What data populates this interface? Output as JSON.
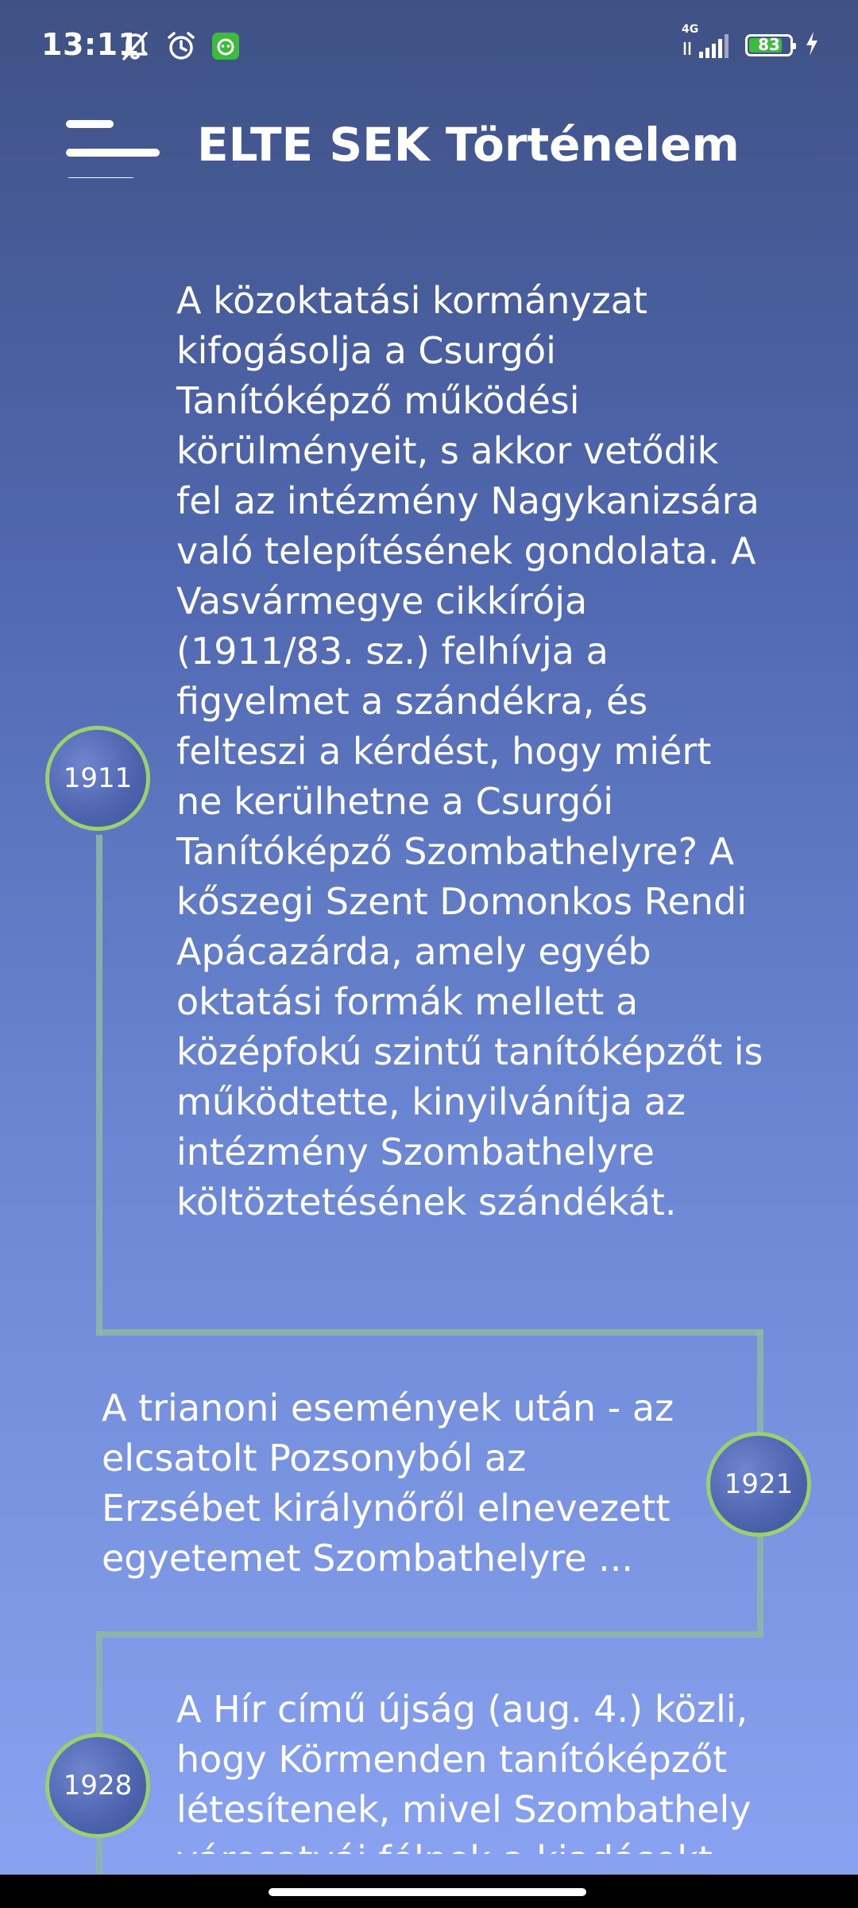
{
  "status_bar": {
    "time": "13:11",
    "network": "4G",
    "battery": "83",
    "battery_level": 0.83,
    "icons_left": [
      "mute-bell-icon",
      "alarm-icon",
      "app-notification-icon"
    ],
    "icons_right": [
      "signal-icon",
      "battery-icon",
      "charging-icon"
    ]
  },
  "app_bar": {
    "title": "ELTE SEK Történelem",
    "menu_icon": "hamburger-menu-icon"
  },
  "colors": {
    "background_top": "#3f5185",
    "background_bottom": "#8aa3f2",
    "circle_border": "#9ccf6f",
    "timeline": "#8eb9a4",
    "battery_fill": "#3dbb3d"
  },
  "timeline": [
    {
      "year": "1911",
      "text": "A közoktatási kormányzat kifogásolja a Csurgói Tanítóképző működési körülményeit, s akkor vetődik fel az intézmény Nagykanizsára való telepítésének gondolata. A Vasvármegye cikkírója (1911/83. sz.) felhívja a figyelmet a szándékra, és felteszi a kérdést, hogy miért ne kerülhetne a Csurgói Tanítóképző Szombathelyre? A kőszegi Szent Domonkos Rendi Apácazárda, amely egyéb oktatási formák mellett a középfokú szintű tanítóképzőt is működtette, kinyilvánítja az intézmény Szombathelyre költöztetésének szándékát."
    },
    {
      "year": "1921",
      "text": "A trianoni események után - az elcsatolt Pozsonyból az Erzsébet királynőről elnevezett egyetemet Szombathelyre ..."
    },
    {
      "year": "1928",
      "text": "A Hír című újság (aug. 4.) közli, hogy Körmenden tanítóképzőt létesítenek, mivel Szombathely városatyái félnek a kiadásokt"
    }
  ]
}
